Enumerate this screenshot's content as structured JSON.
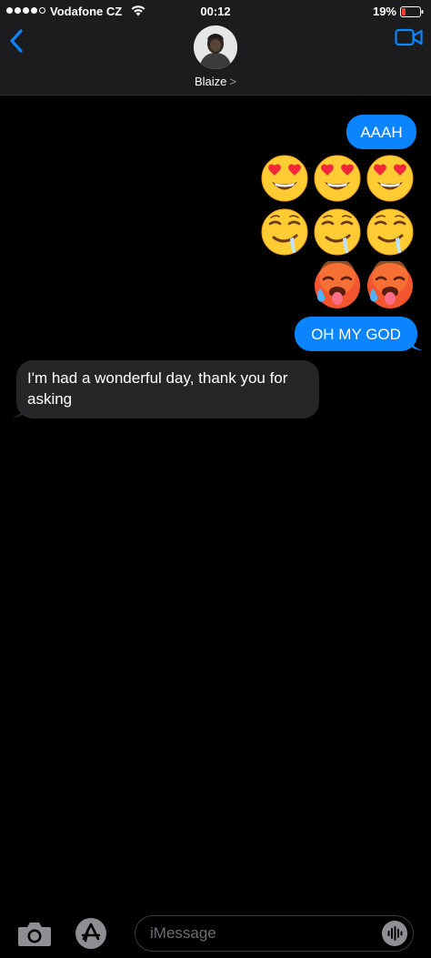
{
  "status_bar": {
    "carrier": "Vodafone CZ",
    "time": "00:12",
    "battery_percent": "19%",
    "signal_dots": 5,
    "signal_filled": 4,
    "battery_level": 0.19,
    "battery_color": "#ff3b30"
  },
  "nav": {
    "contact_name": "Blaize",
    "chevron": ">",
    "accent_color": "#0a84ff"
  },
  "messages": [
    {
      "direction": "sent",
      "type": "text",
      "text": "AAAH"
    },
    {
      "direction": "sent",
      "type": "emoji",
      "rows": [
        [
          "smiling-face-with-heart-eyes",
          "smiling-face-with-heart-eyes",
          "smiling-face-with-heart-eyes"
        ],
        [
          "drooling-face",
          "drooling-face",
          "drooling-face"
        ],
        [
          "hot-face",
          "hot-face"
        ]
      ]
    },
    {
      "direction": "sent",
      "type": "text",
      "text": "OH MY GOD"
    },
    {
      "direction": "received",
      "type": "text",
      "text": "I'm had a wonderful day, thank you for asking"
    }
  ],
  "composer": {
    "placeholder": "iMessage"
  },
  "icons": {
    "back": "chevron-left-icon",
    "video": "video-camera-icon",
    "camera": "camera-icon",
    "appstore": "app-store-icon",
    "audio": "audio-waveform-icon"
  },
  "colors": {
    "sent_bubble": "#0a84ff",
    "received_bubble": "#262628",
    "background": "#000000"
  }
}
